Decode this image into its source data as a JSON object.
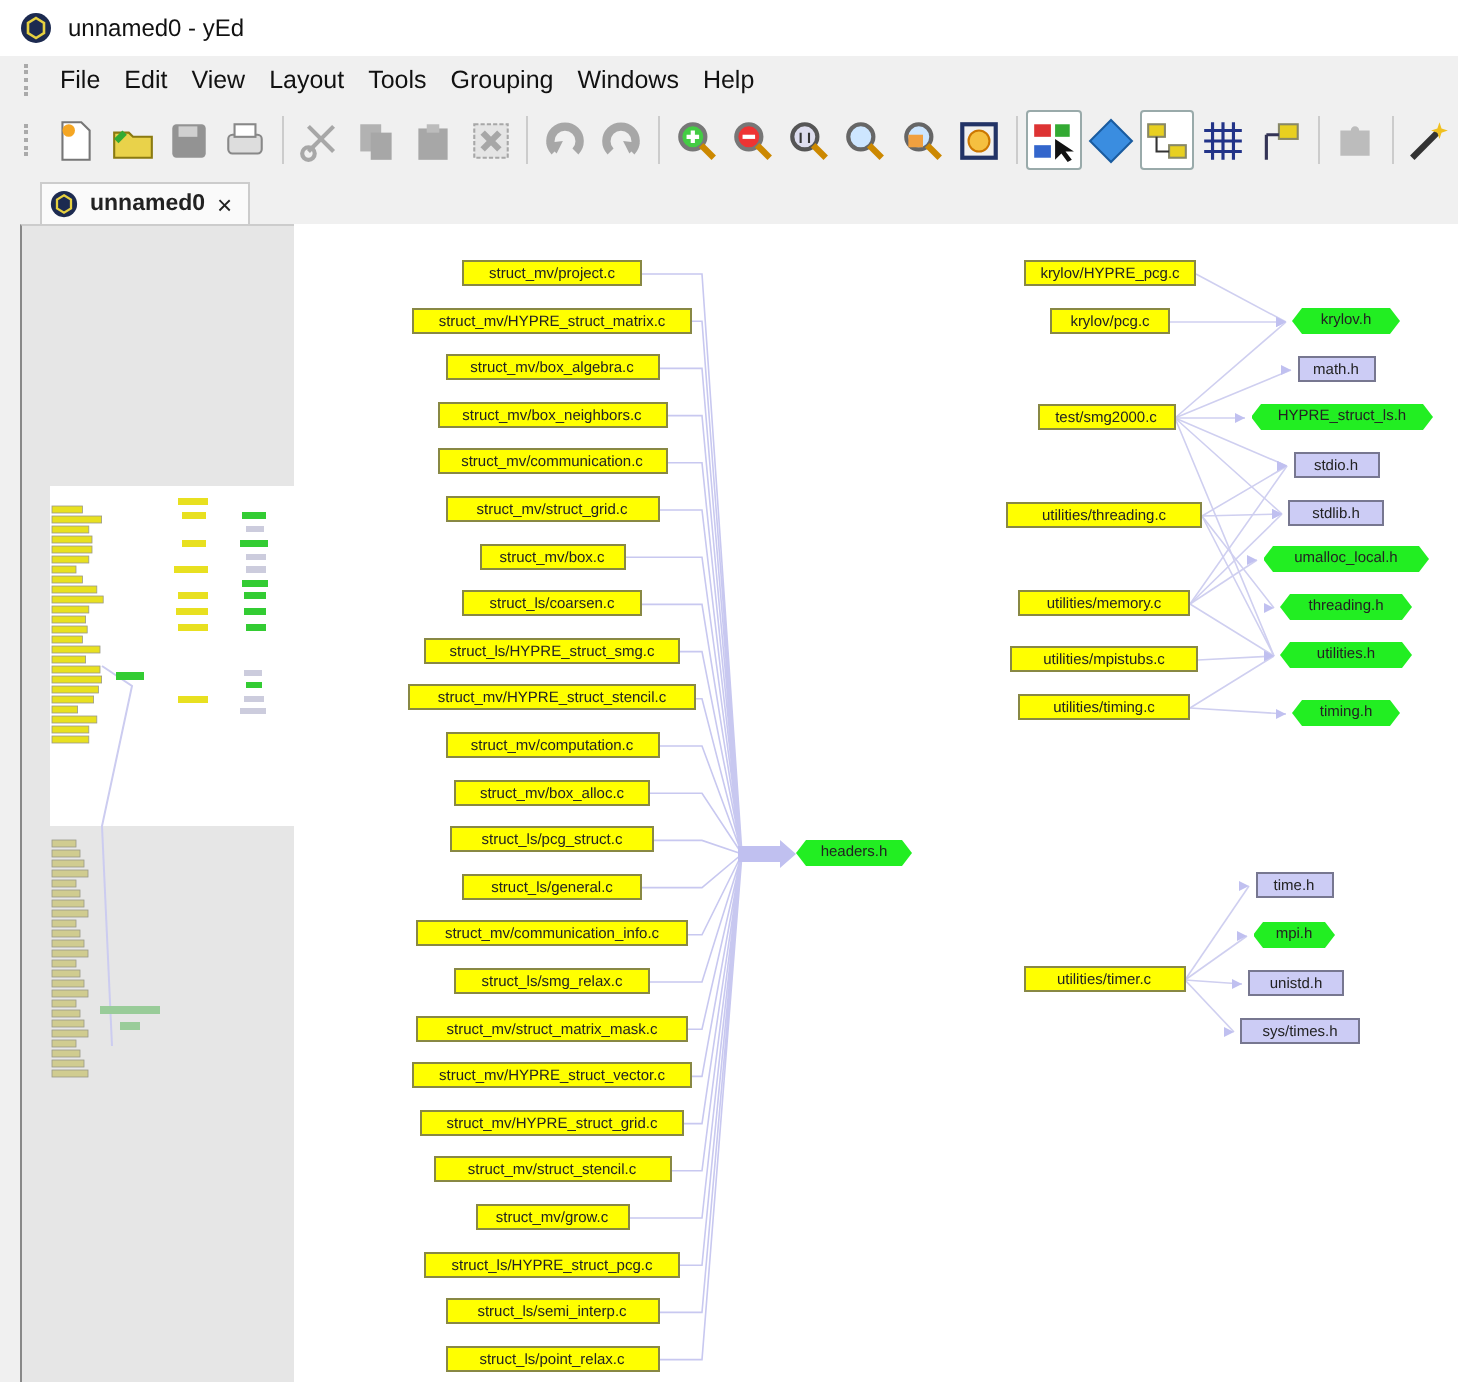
{
  "window": {
    "title": "unnamed0 - yEd"
  },
  "menu": [
    "File",
    "Edit",
    "View",
    "Layout",
    "Tools",
    "Grouping",
    "Windows",
    "Help"
  ],
  "toolbar": [
    {
      "pressed": false,
      "disabled": false
    },
    {
      "pressed": false,
      "disabled": false
    },
    {
      "pressed": false,
      "disabled": true
    },
    {
      "pressed": false,
      "disabled": false
    },
    {
      "pressed": false,
      "disabled": true
    },
    {
      "pressed": false,
      "disabled": true
    },
    {
      "pressed": false,
      "disabled": true
    },
    {
      "pressed": false,
      "disabled": true
    },
    {
      "pressed": false,
      "disabled": true
    },
    {
      "pressed": false,
      "disabled": true
    },
    {
      "pressed": false,
      "disabled": false
    },
    {
      "pressed": false,
      "disabled": false
    },
    {
      "pressed": false,
      "disabled": false
    },
    {
      "pressed": false,
      "disabled": false
    },
    {
      "pressed": false,
      "disabled": false
    },
    {
      "pressed": false,
      "disabled": false
    },
    {
      "pressed": true,
      "disabled": false
    },
    {
      "pressed": false,
      "disabled": false
    },
    {
      "pressed": true,
      "disabled": false
    },
    {
      "pressed": false,
      "disabled": false
    },
    {
      "pressed": false,
      "disabled": false
    },
    {
      "pressed": false,
      "disabled": true
    },
    {
      "pressed": false,
      "disabled": false
    }
  ],
  "tabs": [
    {
      "label": "unnamed0",
      "close": "×",
      "selected": true
    }
  ],
  "graph": {
    "left_sources": [
      {
        "label": "struct_mv/project.c"
      },
      {
        "label": "struct_mv/HYPRE_struct_matrix.c"
      },
      {
        "label": "struct_mv/box_algebra.c"
      },
      {
        "label": "struct_mv/box_neighbors.c"
      },
      {
        "label": "struct_mv/communication.c"
      },
      {
        "label": "struct_mv/struct_grid.c"
      },
      {
        "label": "struct_mv/box.c"
      },
      {
        "label": "struct_ls/coarsen.c"
      },
      {
        "label": "struct_ls/HYPRE_struct_smg.c"
      },
      {
        "label": "struct_mv/HYPRE_struct_stencil.c"
      },
      {
        "label": "struct_mv/computation.c"
      },
      {
        "label": "struct_mv/box_alloc.c"
      },
      {
        "label": "struct_ls/pcg_struct.c"
      },
      {
        "label": "struct_ls/general.c"
      },
      {
        "label": "struct_mv/communication_info.c"
      },
      {
        "label": "struct_ls/smg_relax.c"
      },
      {
        "label": "struct_mv/struct_matrix_mask.c"
      },
      {
        "label": "struct_mv/HYPRE_struct_vector.c"
      },
      {
        "label": "struct_mv/HYPRE_struct_grid.c"
      },
      {
        "label": "struct_mv/struct_stencil.c"
      },
      {
        "label": "struct_mv/grow.c"
      },
      {
        "label": "struct_ls/HYPRE_struct_pcg.c"
      },
      {
        "label": "struct_ls/semi_interp.c"
      },
      {
        "label": "struct_ls/point_relax.c"
      }
    ],
    "hub": {
      "label": "headers.h",
      "kind": "project"
    },
    "right_sources": [
      {
        "label": "krylov/HYPRE_pcg.c"
      },
      {
        "label": "krylov/pcg.c"
      },
      {
        "label": "test/smg2000.c"
      },
      {
        "label": "utilities/threading.c"
      },
      {
        "label": "utilities/memory.c"
      },
      {
        "label": "utilities/mpistubs.c"
      },
      {
        "label": "utilities/timing.c"
      },
      {
        "label": "utilities/timer.c"
      }
    ],
    "headers": [
      {
        "label": "krylov.h",
        "kind": "project"
      },
      {
        "label": "math.h",
        "kind": "system"
      },
      {
        "label": "HYPRE_struct_ls.h",
        "kind": "project"
      },
      {
        "label": "stdio.h",
        "kind": "system"
      },
      {
        "label": "stdlib.h",
        "kind": "system"
      },
      {
        "label": "umalloc_local.h",
        "kind": "project"
      },
      {
        "label": "threading.h",
        "kind": "project"
      },
      {
        "label": "utilities.h",
        "kind": "project"
      },
      {
        "label": "timing.h",
        "kind": "project"
      },
      {
        "label": "time.h",
        "kind": "system"
      },
      {
        "label": "mpi.h",
        "kind": "project"
      },
      {
        "label": "unistd.h",
        "kind": "system"
      },
      {
        "label": "sys/times.h",
        "kind": "system"
      }
    ]
  }
}
